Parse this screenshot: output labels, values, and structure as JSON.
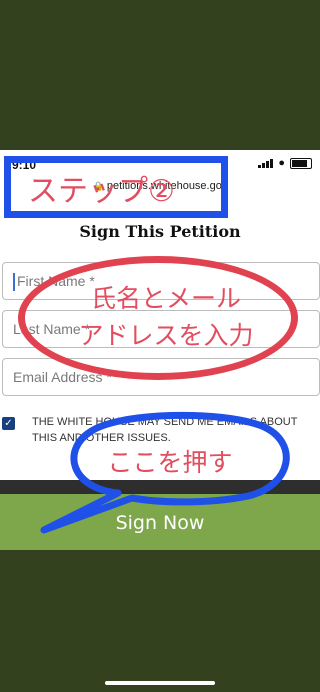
{
  "status_bar": {
    "time": "9:10",
    "location_arrow": "➚"
  },
  "browser": {
    "url": "petitions.whitehouse.gov"
  },
  "form": {
    "title": "Sign This Petition",
    "first_name_placeholder": "First Name *",
    "last_name_placeholder": "Last Name *",
    "email_placeholder": "Email Address *",
    "consent_checked": true,
    "consent_text": "THE WHITE HOUSE MAY SEND ME EMAILS ABOUT THIS AND OTHER ISSUES.",
    "sign_button_label": "Sign Now"
  },
  "annotations": {
    "step_label": "ステップ②",
    "name_email_instruction_line1": "氏名とメール",
    "name_email_instruction_line2": "アドレスを入力",
    "press_here": "ここを押す"
  },
  "colors": {
    "background": "#34411e",
    "button": "#7ea64b",
    "checkbox": "#17407e",
    "annotation_blue": "#1f50e8",
    "annotation_red": "#e0424f"
  }
}
